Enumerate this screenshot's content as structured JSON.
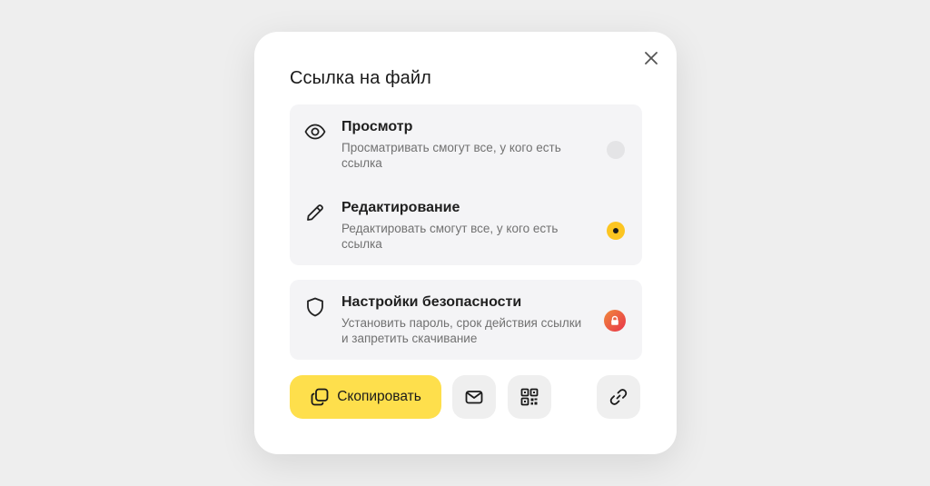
{
  "dialog": {
    "title": "Ссылка на файл",
    "close_icon": "close-icon"
  },
  "access_options": [
    {
      "icon": "eye-icon",
      "title": "Просмотр",
      "description": "Просматривать смогут все, у кого есть ссылка",
      "selected": false
    },
    {
      "icon": "pencil-icon",
      "title": "Редактирование",
      "description": "Редактировать смогут все, у кого есть ссылка",
      "selected": true
    }
  ],
  "security": {
    "icon": "shield-icon",
    "title": "Настройки безопасности",
    "description": "Установить пароль, срок действия ссылки и запретить скачивание",
    "badge_icon": "lock-icon"
  },
  "actions": {
    "copy_label": "Скопировать",
    "copy_icon": "copy-icon",
    "mail_icon": "mail-icon",
    "qr_icon": "qr-code-icon",
    "link_icon": "link-icon"
  },
  "colors": {
    "accent": "#fedf4c",
    "radio_selected": "#fcc521",
    "security_badge": "#e8334a"
  }
}
